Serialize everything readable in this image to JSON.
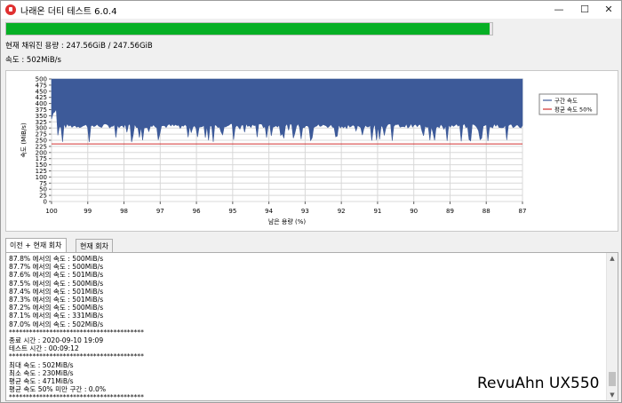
{
  "window": {
    "title": "나래온 더티 테스트 6.0.4",
    "minimize_glyph": "—",
    "maximize_glyph": "☐",
    "close_glyph": "✕"
  },
  "progress": {
    "fraction": 0.995,
    "color": "#06b025"
  },
  "status": {
    "filled_capacity": "현재 채워진 용량 : 247.56GiB / 247.56GiB",
    "speed": "속도 : 502MiB/s"
  },
  "chart_data": {
    "type": "area",
    "ylabel": "속도 (MiB/s)",
    "xlabel": "남은 용량 (%)",
    "x_ticks": [
      "100",
      "99",
      "98",
      "97",
      "96",
      "95",
      "94",
      "93",
      "92",
      "91",
      "90",
      "89",
      "88",
      "87"
    ],
    "y_ticks": [
      "0",
      "25",
      "50",
      "75",
      "100",
      "125",
      "150",
      "175",
      "200",
      "225",
      "250",
      "275",
      "300",
      "325",
      "350",
      "375",
      "400",
      "425",
      "450",
      "475",
      "500"
    ],
    "xlim": [
      100,
      87
    ],
    "ylim": [
      0,
      500
    ],
    "grid": true,
    "legend_position": "right",
    "series": [
      {
        "name": "구간 속도",
        "color": "#3d5a99",
        "peak": 500,
        "typical_min": 300,
        "dip_min": 240,
        "initial_dip": 330
      },
      {
        "name": "평균 속도 50%",
        "color": "#d03030",
        "value": 235
      }
    ]
  },
  "tabs": [
    {
      "label": "이전 + 현재 회차"
    },
    {
      "label": "현재 회차"
    }
  ],
  "log": {
    "lines": [
      "87.8% 에서의 속도 : 500MiB/s",
      "87.7% 에서의 속도 : 500MiB/s",
      "87.6% 에서의 속도 : 501MiB/s",
      "87.5% 에서의 속도 : 500MiB/s",
      "87.4% 에서의 속도 : 501MiB/s",
      "87.3% 에서의 속도 : 501MiB/s",
      "87.2% 에서의 속도 : 500MiB/s",
      "87.1% 에서의 속도 : 331MiB/s",
      "87.0% 에서의 속도 : 502MiB/s",
      "****************************************",
      "종료 시간 : 2020-09-10 19:09",
      "테스트 시간 : 00:09:12",
      "****************************************",
      "최대 속도 : 502MiB/s",
      "최소 속도 : 230MiB/s",
      "평균 속도 : 471MiB/s",
      "평균 속도 50% 미만 구간 : 0.0%",
      "****************************************"
    ],
    "scroll_up_glyph": "▲",
    "scroll_down_glyph": "▼"
  },
  "watermark": "RevuAhn UX550"
}
